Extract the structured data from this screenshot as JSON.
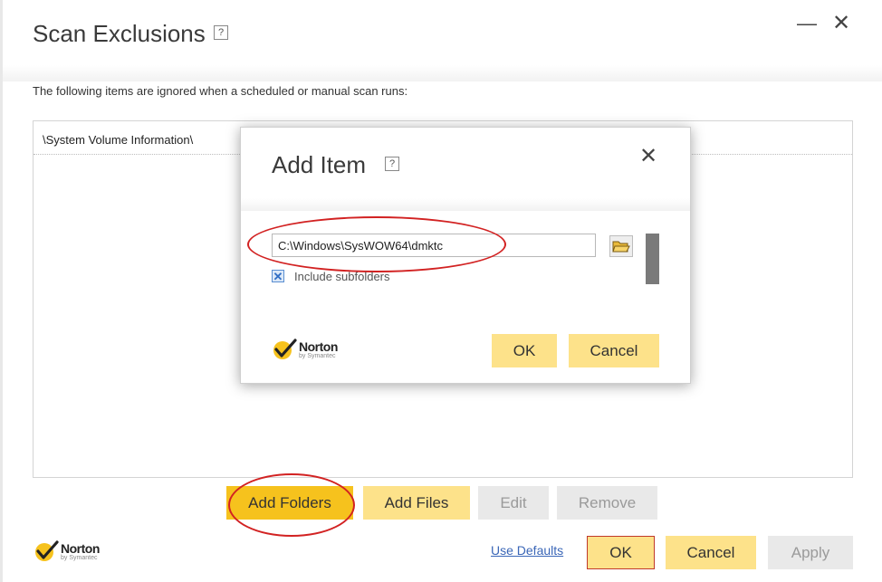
{
  "window": {
    "title": "Scan Exclusions",
    "help_glyph": "?",
    "minimize_glyph": "—",
    "close_glyph": "✕",
    "description": "The following items are ignored when a scheduled or manual scan runs:"
  },
  "exclusions": {
    "items": [
      "\\System Volume Information\\"
    ]
  },
  "actions": {
    "add_folders": "Add Folders",
    "add_files": "Add Files",
    "edit": "Edit",
    "remove": "Remove"
  },
  "footer": {
    "use_defaults": "Use Defaults",
    "ok": "OK",
    "cancel": "Cancel",
    "apply": "Apply"
  },
  "brand": {
    "name": "Norton",
    "sub": "by Symantec"
  },
  "dialog": {
    "title": "Add Item",
    "help_glyph": "?",
    "close_glyph": "✕",
    "path_value": "C:\\Windows\\SysWOW64\\dmktc",
    "include_subfolders_label": "Include subfolders",
    "include_subfolders_checked": true,
    "check_glyph": "✕",
    "ok": "OK",
    "cancel": "Cancel"
  },
  "icons": {
    "folder": "open-folder-icon",
    "norton": "norton-check-icon"
  },
  "colors": {
    "accent_yellow": "#f6c21d",
    "button_yellow": "#fde28a",
    "disabled_gray": "#e9e9e9",
    "annotation_red": "#d22222",
    "link_blue": "#3a66b7"
  }
}
